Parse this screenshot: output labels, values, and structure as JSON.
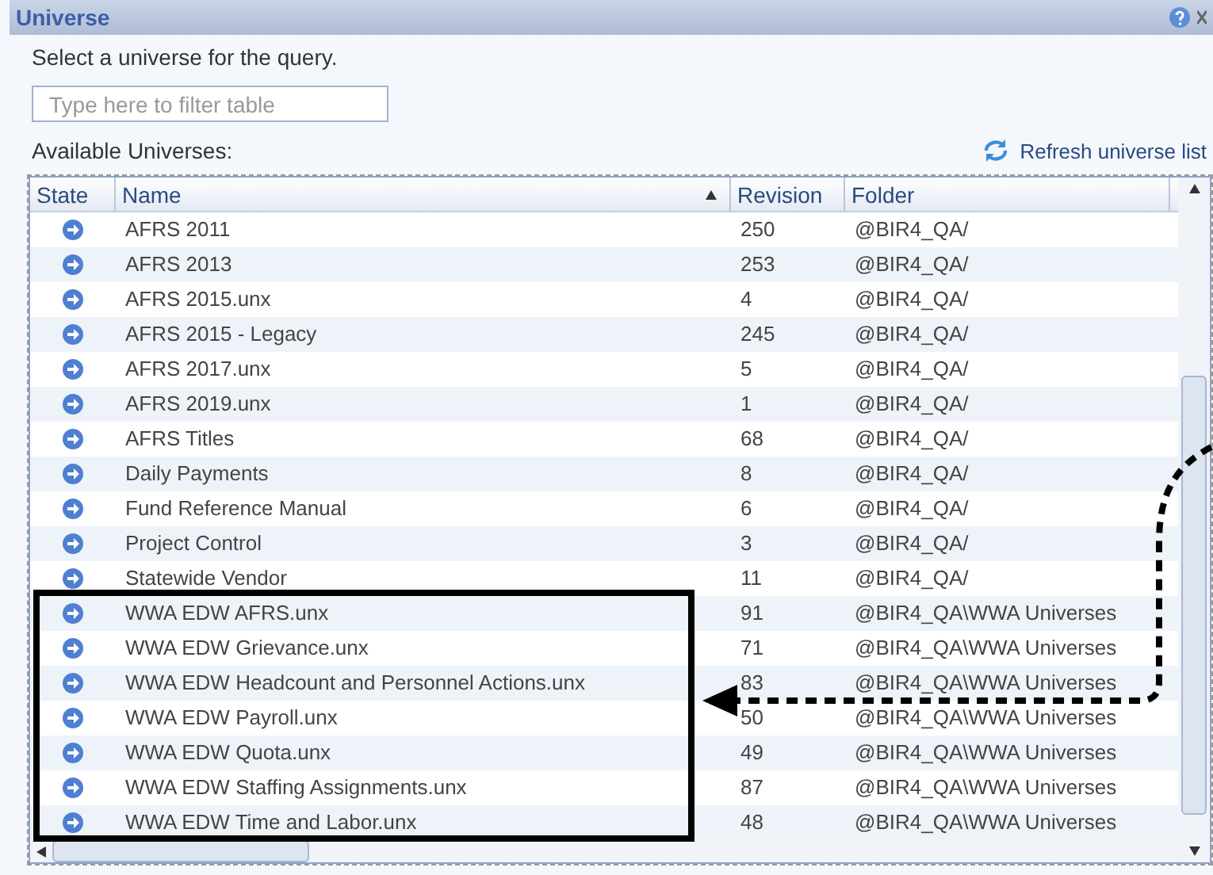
{
  "window": {
    "title": "Universe"
  },
  "instruction": "Select a universe for the query.",
  "filter": {
    "placeholder": "Type here to filter table"
  },
  "list_label": "Available Universes:",
  "refresh_link": "Refresh universe list",
  "table": {
    "columns": [
      {
        "label": "State",
        "sorted": false
      },
      {
        "label": "Name",
        "sorted": true
      },
      {
        "label": "Revision",
        "sorted": false
      },
      {
        "label": "Folder",
        "sorted": false
      }
    ],
    "rows": [
      {
        "name": "AFRS 2011",
        "revision": "250",
        "folder": "@BIR4_QA/"
      },
      {
        "name": "AFRS 2013",
        "revision": "253",
        "folder": "@BIR4_QA/"
      },
      {
        "name": "AFRS 2015.unx",
        "revision": "4",
        "folder": "@BIR4_QA/"
      },
      {
        "name": "AFRS 2015 - Legacy",
        "revision": "245",
        "folder": "@BIR4_QA/"
      },
      {
        "name": "AFRS 2017.unx",
        "revision": "5",
        "folder": "@BIR4_QA/"
      },
      {
        "name": "AFRS 2019.unx",
        "revision": "1",
        "folder": "@BIR4_QA/"
      },
      {
        "name": "AFRS Titles",
        "revision": "68",
        "folder": "@BIR4_QA/"
      },
      {
        "name": "Daily Payments",
        "revision": "8",
        "folder": "@BIR4_QA/"
      },
      {
        "name": "Fund Reference Manual",
        "revision": "6",
        "folder": "@BIR4_QA/"
      },
      {
        "name": "Project Control",
        "revision": "3",
        "folder": "@BIR4_QA/"
      },
      {
        "name": "Statewide Vendor",
        "revision": "11",
        "folder": "@BIR4_QA/"
      },
      {
        "name": "WWA EDW AFRS.unx",
        "revision": "91",
        "folder": "@BIR4_QA\\WWA Universes"
      },
      {
        "name": "WWA EDW Grievance.unx",
        "revision": "71",
        "folder": "@BIR4_QA\\WWA Universes"
      },
      {
        "name": "WWA EDW Headcount and Personnel Actions.unx",
        "revision": "83",
        "folder": "@BIR4_QA\\WWA Universes"
      },
      {
        "name": "WWA EDW Payroll.unx",
        "revision": "50",
        "folder": "@BIR4_QA\\WWA Universes"
      },
      {
        "name": "WWA EDW Quota.unx",
        "revision": "49",
        "folder": "@BIR4_QA\\WWA Universes"
      },
      {
        "name": "WWA EDW Staffing Assignments.unx",
        "revision": "87",
        "folder": "@BIR4_QA\\WWA Universes"
      },
      {
        "name": "WWA EDW Time and Labor.unx",
        "revision": "48",
        "folder": "@BIR4_QA\\WWA Universes"
      }
    ]
  }
}
